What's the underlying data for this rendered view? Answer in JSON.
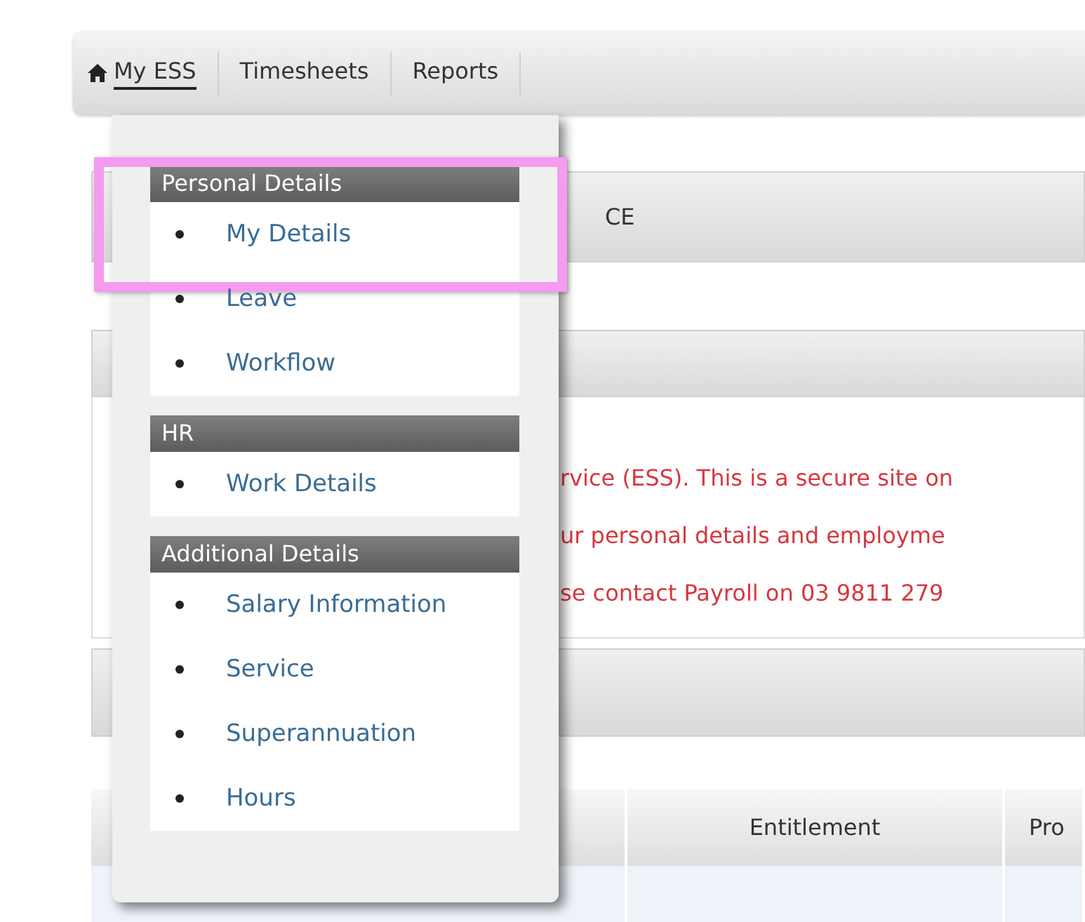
{
  "nav": {
    "items": [
      {
        "label": "My ESS",
        "selected": true
      },
      {
        "label": "Timesheets",
        "selected": false
      },
      {
        "label": "Reports",
        "selected": false
      }
    ]
  },
  "content": {
    "panel_title": "CE",
    "notice_lines": [
      "rvice (ESS). This is a secure site on",
      "ur personal details and employme",
      "se contact Payroll on 03 9811 279"
    ],
    "table": {
      "columns": [
        "Entitlement",
        "Pro"
      ]
    }
  },
  "dropdown": {
    "sections": [
      {
        "title": "Personal Details",
        "items": [
          {
            "label": "My Details",
            "highlighted": true
          },
          {
            "label": "Leave",
            "highlighted": false
          },
          {
            "label": "Workflow",
            "highlighted": false
          }
        ]
      },
      {
        "title": "HR",
        "items": [
          {
            "label": "Work Details",
            "highlighted": false
          }
        ]
      },
      {
        "title": "Additional Details",
        "items": [
          {
            "label": "Salary Information",
            "highlighted": false
          },
          {
            "label": "Service",
            "highlighted": false
          },
          {
            "label": "Superannuation",
            "highlighted": false
          },
          {
            "label": "Hours",
            "highlighted": false
          }
        ]
      }
    ]
  }
}
